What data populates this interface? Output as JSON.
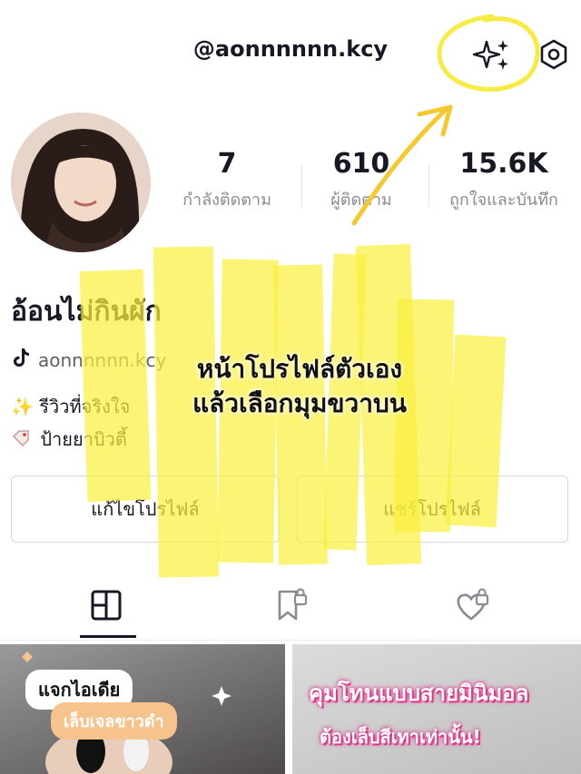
{
  "header": {
    "username": "@aonnnnnn.kcy",
    "spark_icon": "sparkles-icon",
    "settings_icon": "hexagon-settings-icon"
  },
  "stats": [
    {
      "value": "7",
      "label": "กำลังติดตาม"
    },
    {
      "value": "610",
      "label": "ผู้ติดตาม"
    },
    {
      "value": "15.6K",
      "label": "ถูกใจและบันทึก"
    }
  ],
  "profile": {
    "display_name": "อ้อนไม่กินผัก",
    "handle": "aonnnnnn.kcy",
    "bio_line1": "✨ รีวิวที่จริงใจ",
    "bio_line2": "ป้ายยาบิวตี้"
  },
  "buttons": {
    "edit_label": "แก้ไขโปรไฟล์",
    "share_label": "แชร์โปรไฟล์"
  },
  "tabs": [
    {
      "icon": "grid-icon"
    },
    {
      "icon": "bookmark-lock-icon"
    },
    {
      "icon": "heart-lock-icon"
    }
  ],
  "posts": [
    {
      "title": "แจกไอเดีย",
      "subtitle": "เล็บเจลขาวดำ"
    },
    {
      "title": "คุมโทนแบบสายมินิมอล",
      "subtitle": "ต้องเล็บสีเทาเท่านั้น!"
    }
  ],
  "annotation": {
    "line1": "หน้าโปรไฟล์ตัวเอง",
    "line2": "แล้วเลือกมุมขวาบน",
    "highlight_color": "#f9f040"
  }
}
